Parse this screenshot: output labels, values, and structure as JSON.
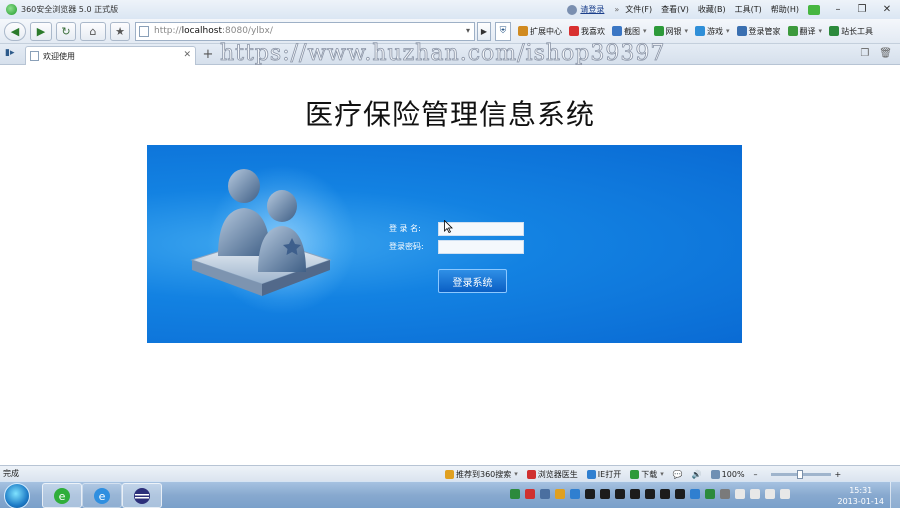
{
  "window": {
    "title": "360安全浏览器 5.0 正式版",
    "login_link": "请登录",
    "chevron": "»",
    "menu": [
      "文件(F)",
      "查看(V)",
      "收藏(B)",
      "工具(T)",
      "帮助(H)"
    ],
    "controls": {
      "minimize": "–",
      "restore": "❐",
      "close": "✕"
    }
  },
  "toolbar": {
    "back": "◀",
    "forward": "▶",
    "refresh": "↻",
    "home": "⌂",
    "favorite": "★",
    "address_prefix": "http://",
    "address_host": "localhost",
    "address_rest": ":8080/ylbx/",
    "address_dropdown": "▾",
    "go": "▶",
    "items": [
      {
        "label": "扩展中心",
        "color": "#d08a20",
        "caret": ""
      },
      {
        "label": "我喜欢",
        "color": "#d83030",
        "caret": ""
      },
      {
        "label": "截图",
        "color": "#3a76c4",
        "caret": "▾"
      },
      {
        "label": "网银",
        "color": "#2d9a3a",
        "caret": "▾"
      },
      {
        "label": "游戏",
        "color": "#2f8fd8",
        "caret": "▾"
      },
      {
        "label": "登录管家",
        "color": "#3a6fb0",
        "caret": ""
      },
      {
        "label": "翻译",
        "color": "#3c9a3c",
        "caret": "▾"
      },
      {
        "label": "站长工具",
        "color": "#2c8a3c",
        "caret": ""
      }
    ]
  },
  "tabs": {
    "active_tab_label": "欢迎使用",
    "close": "✕",
    "new_tab": "+",
    "watermark": "https://www.huzhan.com/ishop39397"
  },
  "page": {
    "title": "医疗保险管理信息系统",
    "username_label": "登 录 名:",
    "password_label": "登录密码:",
    "login_button": "登录系统"
  },
  "statusbar": {
    "status": "完成",
    "items": [
      {
        "label": "推荐到360搜索",
        "color": "#e0a020",
        "caret": "▾"
      },
      {
        "label": "浏览器医生",
        "color": "#d03030",
        "caret": ""
      },
      {
        "label": "IE打开",
        "color": "#2f7fd0",
        "caret": ""
      },
      {
        "label": "下载",
        "color": "#2d9a3a",
        "caret": "▾"
      }
    ],
    "zoom": "100%",
    "zoom_minus": "–",
    "zoom_plus": "+"
  },
  "taskbar": {
    "time": "15:31",
    "date": "2013-01-14"
  }
}
